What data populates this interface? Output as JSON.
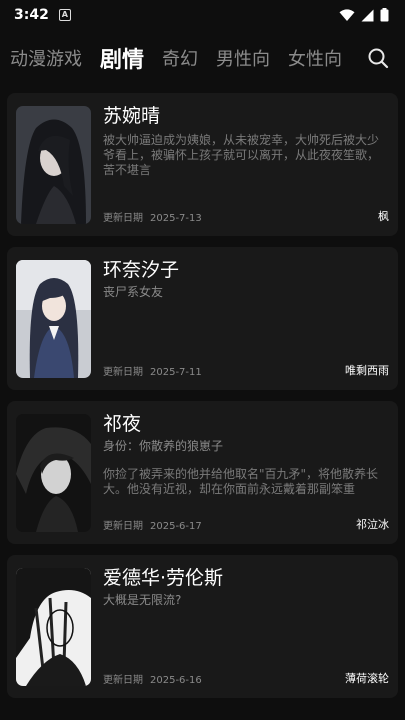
{
  "status_bar": {
    "time": "3:42",
    "notification_badge": "A"
  },
  "tabs": [
    {
      "label": "动漫游戏",
      "active": false
    },
    {
      "label": "剧情",
      "active": true
    },
    {
      "label": "奇幻",
      "active": false
    },
    {
      "label": "男性向",
      "active": false
    },
    {
      "label": "女性向",
      "active": false
    }
  ],
  "cards": [
    {
      "title": "苏婉晴",
      "subtitle": "",
      "description": "被大帅逼迫成为姨娘，从未被宠幸，大帅死后被大少爷看上，被骗怀上孩子就可以离开，从此夜夜笙歌，苦不堪言",
      "date_label": "更新日期",
      "date": "2025-7-13",
      "author": "枫"
    },
    {
      "title": "环奈汐子",
      "subtitle": "丧尸系女友",
      "description": "",
      "date_label": "更新日期",
      "date": "2025-7-11",
      "author": "唯剩西雨"
    },
    {
      "title": "祁夜",
      "subtitle": "身份：你散养的狼崽子",
      "description": "你捡了被弄来的他并给他取名\"百九矛\"，将他散养长大。他没有近视，却在你面前永远戴着那副笨重",
      "date_label": "更新日期",
      "date": "2025-6-17",
      "author": "祁泣冰"
    },
    {
      "title": "爱德华·劳伦斯",
      "subtitle": "大概是无限流?",
      "description": "",
      "date_label": "更新日期",
      "date": "2025-6-16",
      "author": "薄荷滚轮"
    }
  ]
}
